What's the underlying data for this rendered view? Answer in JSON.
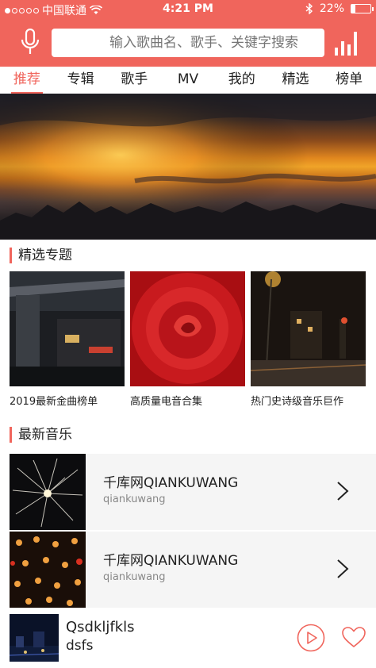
{
  "status": {
    "carrier": "中国联通",
    "time": "4:21 PM",
    "battery_label": "22%",
    "battery_level": 0.22
  },
  "header": {
    "search_placeholder": "输入歌曲名、歌手、关键字搜索",
    "icons": [
      "microphone-icon",
      "equalizer-icon"
    ]
  },
  "tabs": [
    {
      "label": "推荐",
      "active": true
    },
    {
      "label": "专辑",
      "active": false
    },
    {
      "label": "歌手",
      "active": false
    },
    {
      "label": "MV",
      "active": false
    },
    {
      "label": "我的",
      "active": false
    },
    {
      "label": "精选",
      "active": false
    },
    {
      "label": "榜单",
      "active": false
    }
  ],
  "featured": {
    "title": "精选专题",
    "cards": [
      {
        "label": "2019最新金曲榜单"
      },
      {
        "label": "高质量电音合集"
      },
      {
        "label": "热门史诗级音乐巨作"
      }
    ]
  },
  "latest": {
    "title": "最新音乐",
    "rows": [
      {
        "title": "千库网QIANKUWANG",
        "subtitle": "qiankuwang"
      },
      {
        "title": "千库网QIANKUWANG",
        "subtitle": "qiankuwang"
      }
    ]
  },
  "player": {
    "title": "Qsdkljfkls",
    "subtitle": "dsfs"
  },
  "colors": {
    "accent": "#f0655c",
    "row_bg": "#f5f5f5"
  }
}
